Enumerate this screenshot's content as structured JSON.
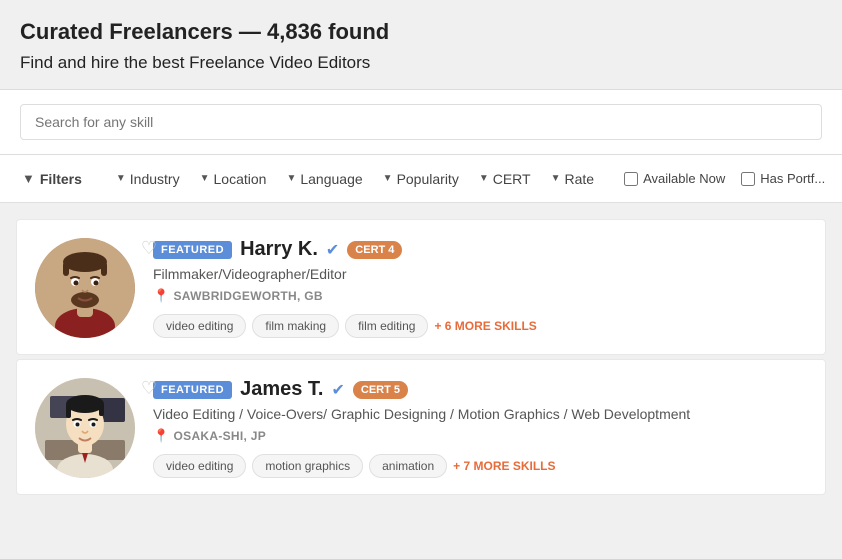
{
  "header": {
    "title": "Curated Freelancers — 4,836 found",
    "subtitle": "Find and hire the best Freelance Video Editors"
  },
  "search": {
    "placeholder": "Search for any skill"
  },
  "filters": {
    "main_label": "Filters",
    "items": [
      {
        "label": "Industry"
      },
      {
        "label": "Location"
      },
      {
        "label": "Language"
      },
      {
        "label": "Popularity"
      },
      {
        "label": "CERT"
      },
      {
        "label": "Rate"
      }
    ],
    "checkboxes": [
      {
        "label": "Available Now"
      },
      {
        "label": "Has Portf..."
      }
    ]
  },
  "freelancers": [
    {
      "featured_label": "FEATURED",
      "name": "Harry K.",
      "cert": "CERT 4",
      "title": "Filmmaker/Videographer/Editor",
      "location": "SAWBRIDGEWORTH, GB",
      "skills": [
        "video editing",
        "film making",
        "film editing"
      ],
      "more_skills": "+ 6 MORE SKILLS"
    },
    {
      "featured_label": "FEATURED",
      "name": "James T.",
      "cert": "CERT 5",
      "title": "Video Editing / Voice-Overs/ Graphic Designing / Motion Graphics / Web Developtment",
      "location": "OSAKA-SHI, JP",
      "skills": [
        "video editing",
        "motion graphics",
        "animation"
      ],
      "more_skills": "+ 7 MORE SKILLS"
    }
  ]
}
